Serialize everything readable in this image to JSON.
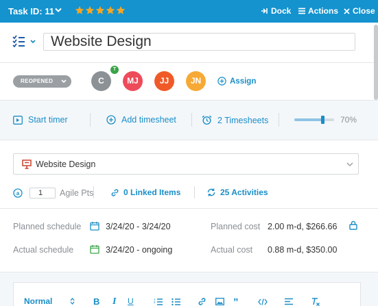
{
  "header": {
    "task_id": "Task ID: 11",
    "stars_filled": 5,
    "dock_label": "Dock",
    "actions_label": "Actions",
    "close_label": "Close"
  },
  "task": {
    "title": "Website Design"
  },
  "status": {
    "label": "REOPENED"
  },
  "assignees": [
    {
      "initials": "C",
      "color": "#8c9196",
      "badge": "T"
    },
    {
      "initials": "MJ",
      "color": "#ee4b5a"
    },
    {
      "initials": "JJ",
      "color": "#f05a28"
    },
    {
      "initials": "JN",
      "color": "#f7a935"
    }
  ],
  "assign_label": "Assign",
  "tools": {
    "start_timer": "Start timer",
    "add_timesheet": "Add timesheet",
    "timesheets": "2 Timesheets",
    "progress_text": "70%",
    "progress_value": 0.7
  },
  "project": {
    "name": "Website Design"
  },
  "agile": {
    "value": "1",
    "unit": "Agile Pts"
  },
  "linked_items": "0 Linked Items",
  "activities": "25 Activities",
  "schedule": {
    "planned_label": "Planned schedule",
    "planned_value": "3/24/20 - 3/24/20",
    "actual_label": "Actual schedule",
    "actual_value": "3/24/20 - ongoing",
    "planned_cost_label": "Planned cost",
    "planned_cost_value": "2.00 m-d, $266.66",
    "actual_cost_label": "Actual cost",
    "actual_cost_value": "0.88 m-d, $350.00"
  },
  "editor": {
    "format": "Normal"
  },
  "colors": {
    "brand": "#1493cf",
    "link": "#1a8ec7",
    "star": "#f6a623"
  }
}
